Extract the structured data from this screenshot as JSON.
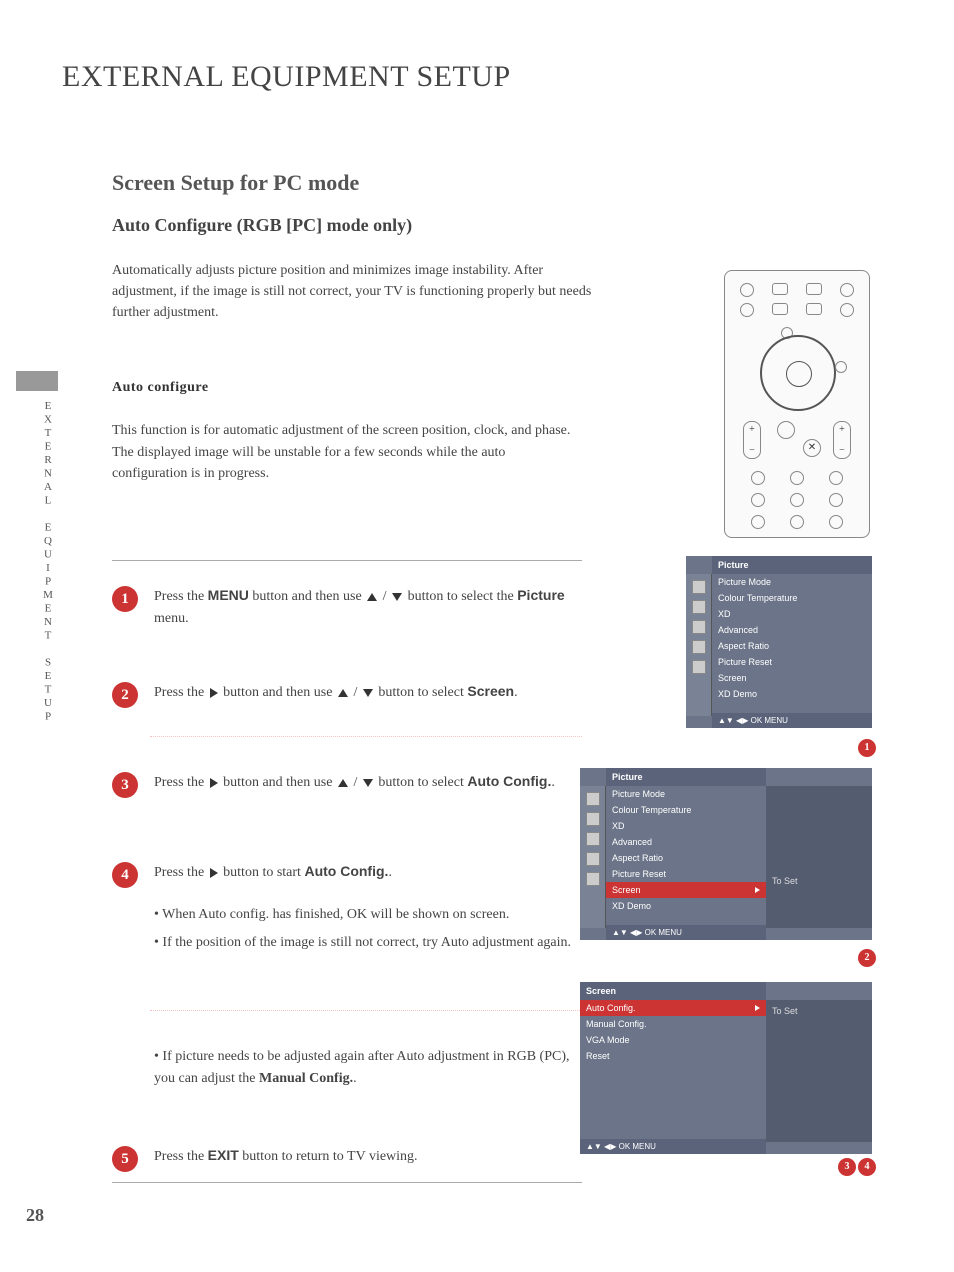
{
  "page_title": "EXTERNAL EQUIPMENT SETUP",
  "side_tab": "EXTERNAL EQUIPMENT SETUP",
  "section_title": "Screen Setup for PC mode",
  "subsection_title": "Auto Configure (RGB [PC] mode only)",
  "intro": "Automatically adjusts picture position and minimizes image instability. After adjustment, if the image is still not correct, your TV is functioning properly but needs further adjustment.",
  "config_heading": "Auto configure",
  "config_desc": "This function is for automatic adjustment of the screen position, clock, and phase. The displayed image will be unstable for a few seconds while the auto configuration is in progress.",
  "steps": {
    "s1_a": "Press the ",
    "s1_b": "MENU",
    "s1_c": " button and then use ",
    "s1_d": " button to select the ",
    "s1_e": "Picture",
    "s1_f": " menu.",
    "s2_a": "Press the ",
    "s2_b": " button and then use ",
    "s2_c": " button to select ",
    "s2_d": "Screen",
    "s2_e": ".",
    "s3_a": "Press the ",
    "s3_b": " button and then use ",
    "s3_c": " button to select ",
    "s3_d": "Auto Config.",
    "s3_e": ".",
    "s4_a": "Press the ",
    "s4_b": " button to start ",
    "s4_c": "Auto Config.",
    "s4_d": ".",
    "b1": "• When Auto config. has finished, OK will be shown on screen.",
    "b2": "• If the position of the image is still not correct, try Auto adjustment again.",
    "b3a": "• If picture needs to be adjusted again after Auto adjustment in RGB (PC), you can adjust the ",
    "b3b": "Manual Config.",
    "b3c": ".",
    "s5_a": "Press the ",
    "s5_b": "EXIT",
    "s5_c": " button to return to TV viewing."
  },
  "menu1": {
    "title": "Picture",
    "items": [
      "Picture Mode",
      "Colour Temperature",
      "XD",
      "Advanced",
      "Aspect Ratio",
      "Picture Reset",
      "Screen",
      "XD Demo"
    ],
    "footer": "OK   MENU"
  },
  "menu2": {
    "title": "Picture",
    "items": [
      "Picture Mode",
      "Colour Temperature",
      "XD",
      "Advanced",
      "Aspect Ratio",
      "Picture Reset",
      "Screen",
      "XD Demo"
    ],
    "highlight_index": 6,
    "side_label": "To Set",
    "footer": "OK   MENU"
  },
  "menu3": {
    "title": "Screen",
    "items": [
      "Auto Config.",
      "Manual Config.",
      "VGA Mode",
      "Reset"
    ],
    "highlight_index": 0,
    "side_label": "To Set",
    "footer": "OK   MENU"
  },
  "badges": {
    "b1": "1",
    "b2": "2",
    "b3": "3",
    "b4": "4"
  },
  "page_number": "28",
  "step_nums": {
    "n1": "1",
    "n2": "2",
    "n3": "3",
    "n4": "4",
    "n5": "5"
  }
}
